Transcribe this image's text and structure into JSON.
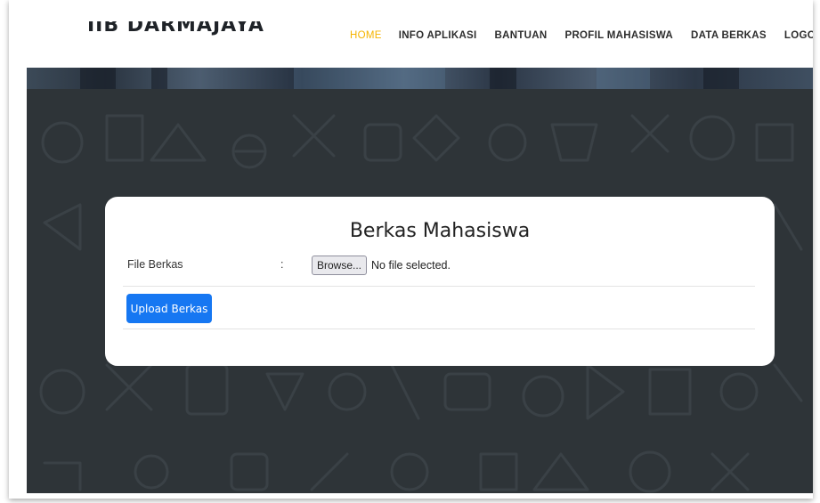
{
  "brand": {
    "name": "IIB DARMAJAYA"
  },
  "nav": {
    "items": [
      {
        "label": "HOME",
        "active": true
      },
      {
        "label": "INFO APLIKASI",
        "active": false
      },
      {
        "label": "BANTUAN",
        "active": false
      },
      {
        "label": "PROFIL MAHASISWA",
        "active": false
      },
      {
        "label": "DATA BERKAS",
        "active": false
      },
      {
        "label": "LOGOUT",
        "active": false
      }
    ]
  },
  "form": {
    "title": "Berkas Mahasiswa",
    "file_label": "File Berkas",
    "separator": ":",
    "browse_label": "Browse...",
    "file_status": "No file selected.",
    "submit_label": "Upload Berkas"
  },
  "colors": {
    "accent_active": "#f5b400",
    "primary_button": "#1677f2",
    "hero_background": "#2e3438"
  }
}
